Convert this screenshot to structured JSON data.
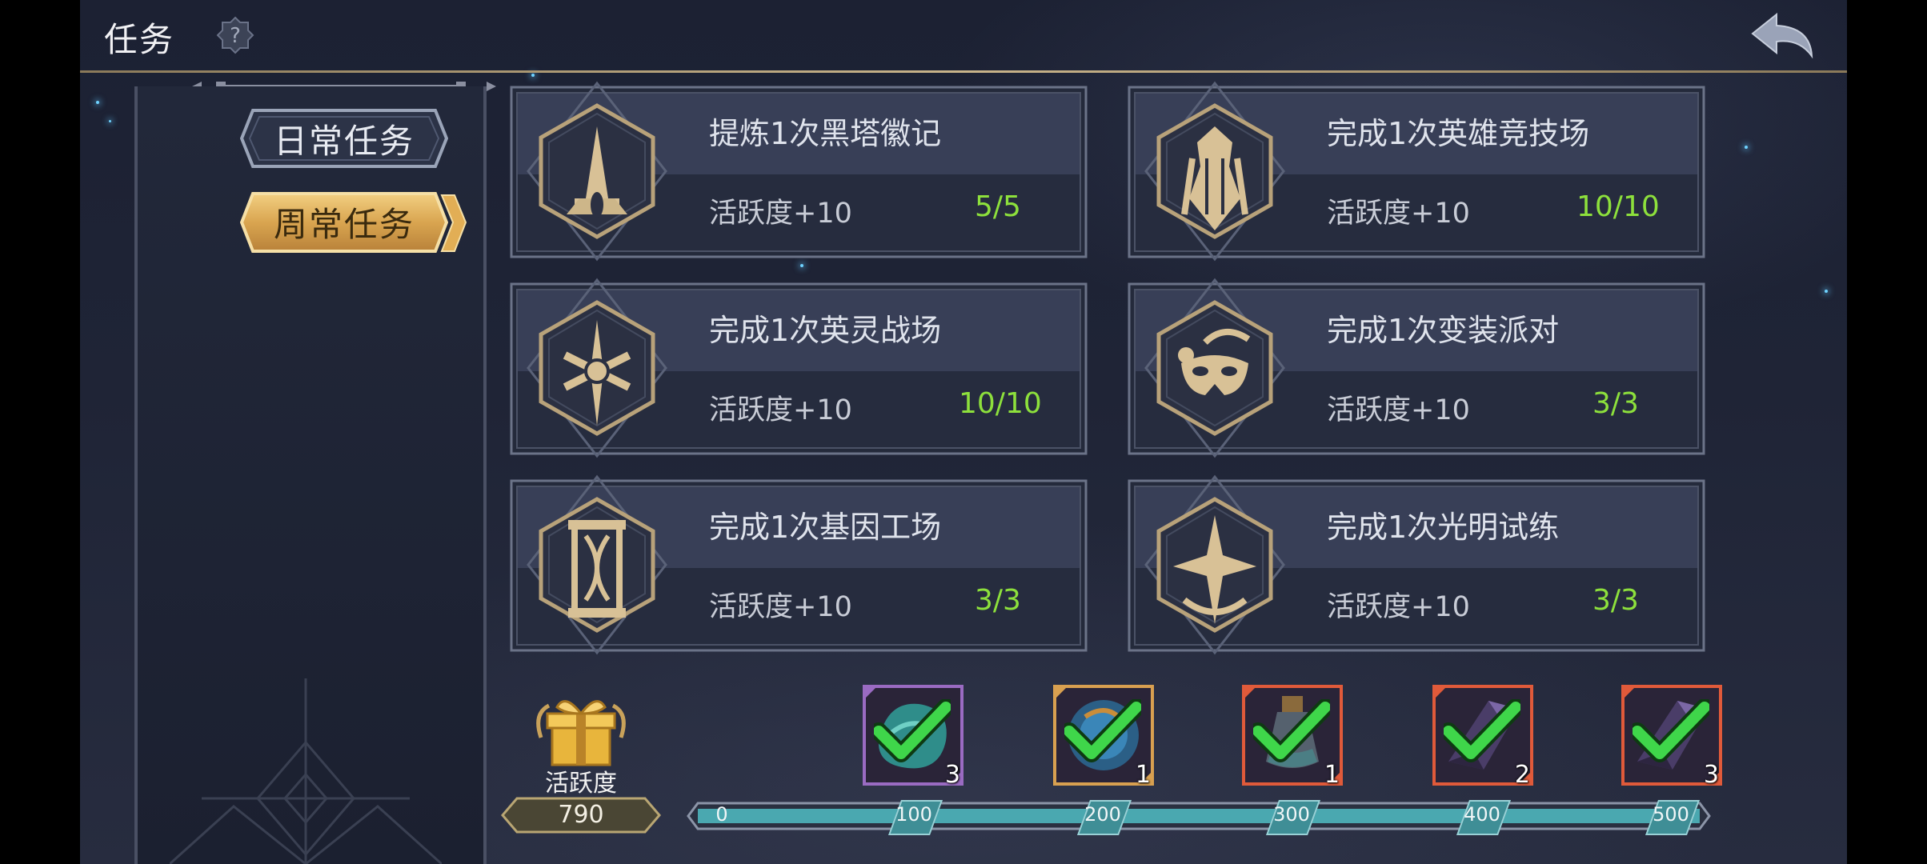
{
  "header": {
    "title": "任务"
  },
  "sidebar": {
    "tabs": [
      {
        "label": "日常任务",
        "active": false
      },
      {
        "label": "周常任务",
        "active": true
      }
    ]
  },
  "tasks": [
    {
      "name": "提炼1次黑塔徽记",
      "reward": "活跃度+10",
      "progress": "5/5",
      "icon": "black-tower-icon"
    },
    {
      "name": "完成1次英雄竞技场",
      "reward": "活跃度+10",
      "progress": "10/10",
      "icon": "hero-arena-icon"
    },
    {
      "name": "完成1次英灵战场",
      "reward": "活跃度+10",
      "progress": "10/10",
      "icon": "spirit-battlefield-icon"
    },
    {
      "name": "完成1次变装派对",
      "reward": "活跃度+10",
      "progress": "3/3",
      "icon": "masquerade-mask-icon"
    },
    {
      "name": "完成1次基因工场",
      "reward": "活跃度+10",
      "progress": "3/3",
      "icon": "dna-hourglass-icon"
    },
    {
      "name": "完成1次光明试练",
      "reward": "活跃度+10",
      "progress": "3/3",
      "icon": "light-trial-icon"
    }
  ],
  "activity": {
    "label": "活跃度",
    "total": "790",
    "ticks": [
      "0",
      "100",
      "200",
      "300",
      "400",
      "500"
    ],
    "fill_fraction": 1.0,
    "rewards": [
      {
        "count": "3",
        "icon": "teal-gem-icon",
        "claimed": true
      },
      {
        "count": "1",
        "icon": "blue-orb-icon",
        "claimed": true
      },
      {
        "count": "1",
        "icon": "potion-bottle-icon",
        "claimed": true
      },
      {
        "count": "2",
        "icon": "purple-crystal-icon",
        "claimed": true
      },
      {
        "count": "3",
        "icon": "purple-crystal-icon",
        "claimed": true
      }
    ]
  },
  "colors": {
    "accent_gold": "#d8b06a",
    "progress_green": "#8de03c",
    "bar_teal": "#4aa8b0"
  }
}
